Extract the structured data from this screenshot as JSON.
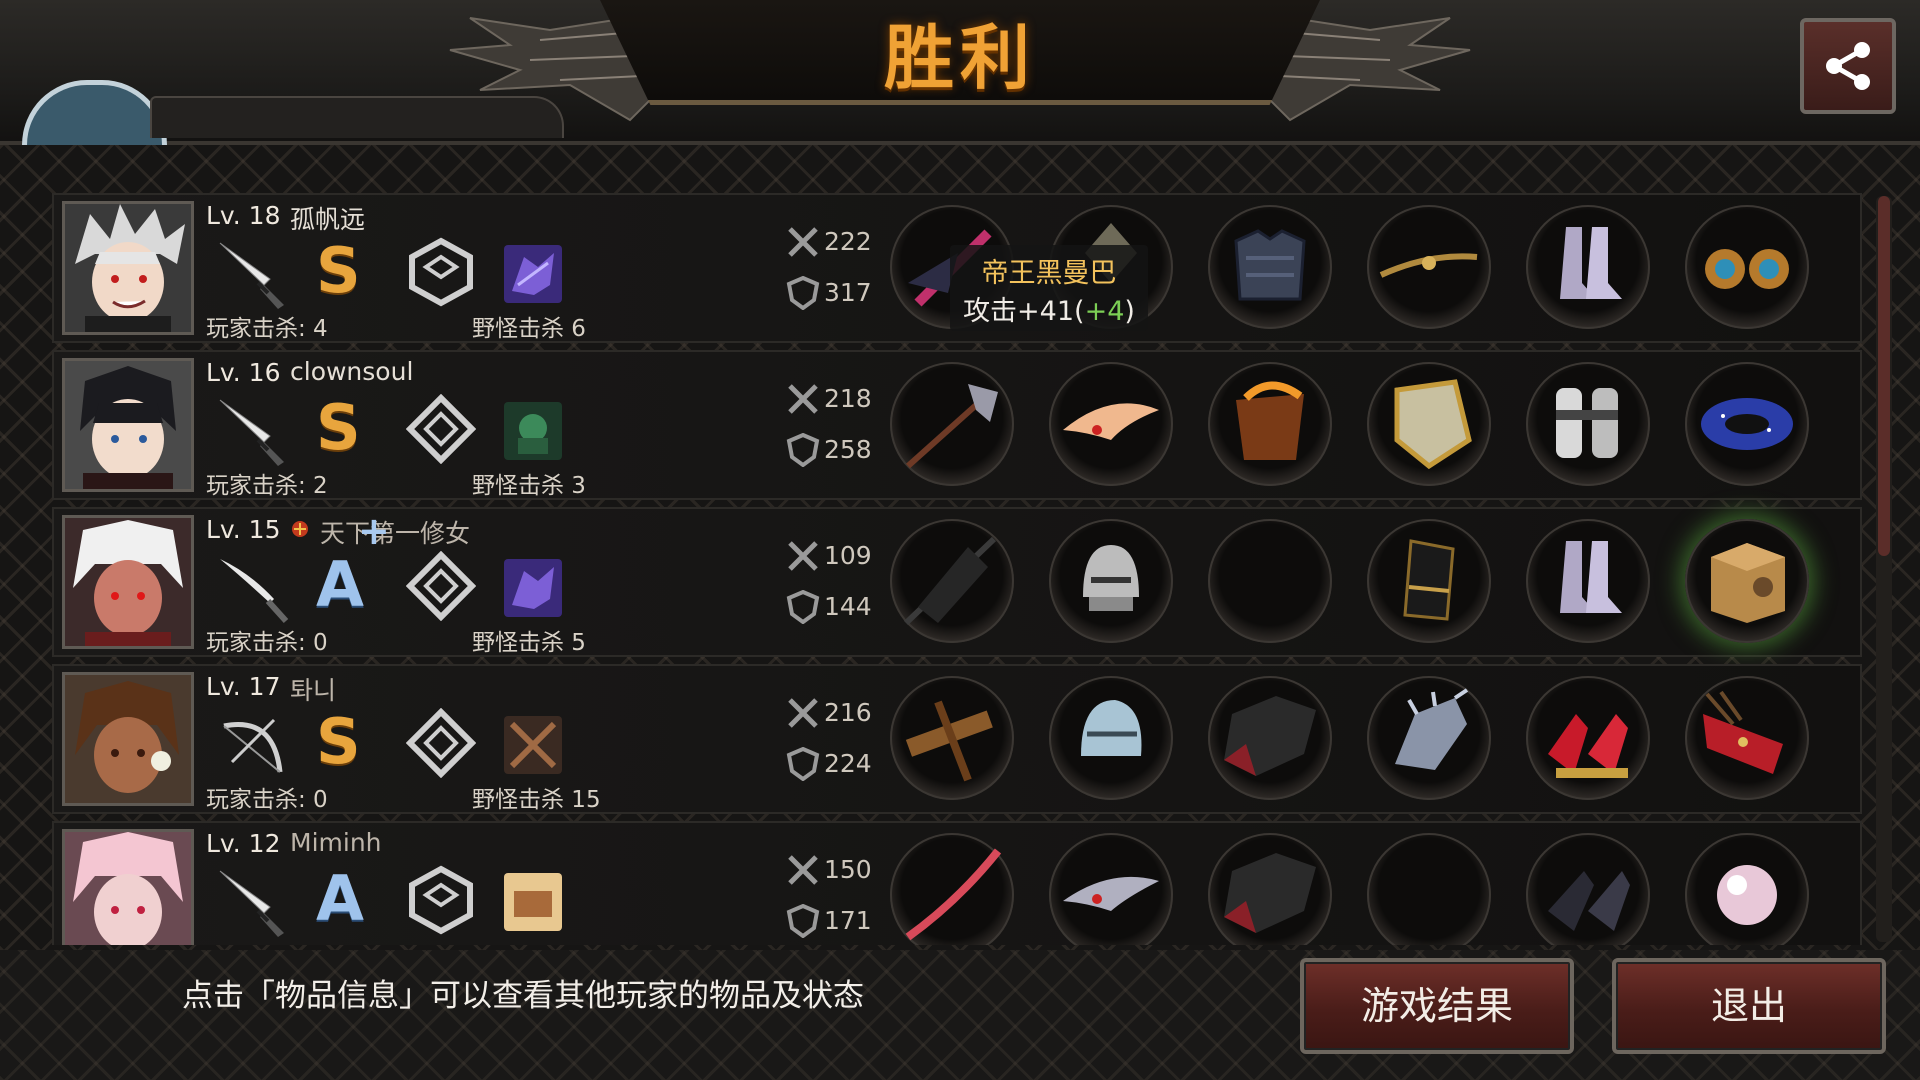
{
  "title": "胜利",
  "tooltip": {
    "name": "帝王黑曼巴",
    "stat_prefix": "攻击+41(",
    "bonus": "+4",
    "stat_suffix": ")"
  },
  "players": [
    {
      "level": "Lv. 18",
      "name": "孤帆远",
      "rank": "S",
      "rank_plus": "",
      "player_kills": "玩家击杀: 4",
      "monster_kills": "野怪击杀 6",
      "attack": "222",
      "defense": "317"
    },
    {
      "level": "Lv. 16",
      "name": "clownsoul",
      "rank": "S",
      "rank_plus": "",
      "player_kills": "玩家击杀: 2",
      "monster_kills": "野怪击杀 3",
      "attack": "218",
      "defense": "258"
    },
    {
      "level": "Lv. 15",
      "name": "天下第一修女",
      "rank": "A",
      "rank_plus": "+",
      "player_kills": "玩家击杀: 0",
      "monster_kills": "野怪击杀 5",
      "attack": "109",
      "defense": "144"
    },
    {
      "level": "Lv. 17",
      "name": "톼니",
      "rank": "S",
      "rank_plus": "",
      "player_kills": "玩家击杀: 0",
      "monster_kills": "野怪击杀 15",
      "attack": "216",
      "defense": "224"
    },
    {
      "level": "Lv. 12",
      "name": "Miminh",
      "rank": "A",
      "rank_plus": "",
      "player_kills": "",
      "monster_kills": "",
      "attack": "150",
      "defense": "171"
    }
  ],
  "hint": "点击「物品信息」可以查看其他玩家的物品及状态",
  "buttons": {
    "result": "游戏结果",
    "exit": "退出"
  },
  "colors": {
    "title": "#f0a235",
    "rank_s": "#e8a53d",
    "rank_a": "#9fc3ec",
    "tooltip_name": "#f3c25c",
    "bonus": "#7ccf55",
    "button": "#5a2520"
  }
}
